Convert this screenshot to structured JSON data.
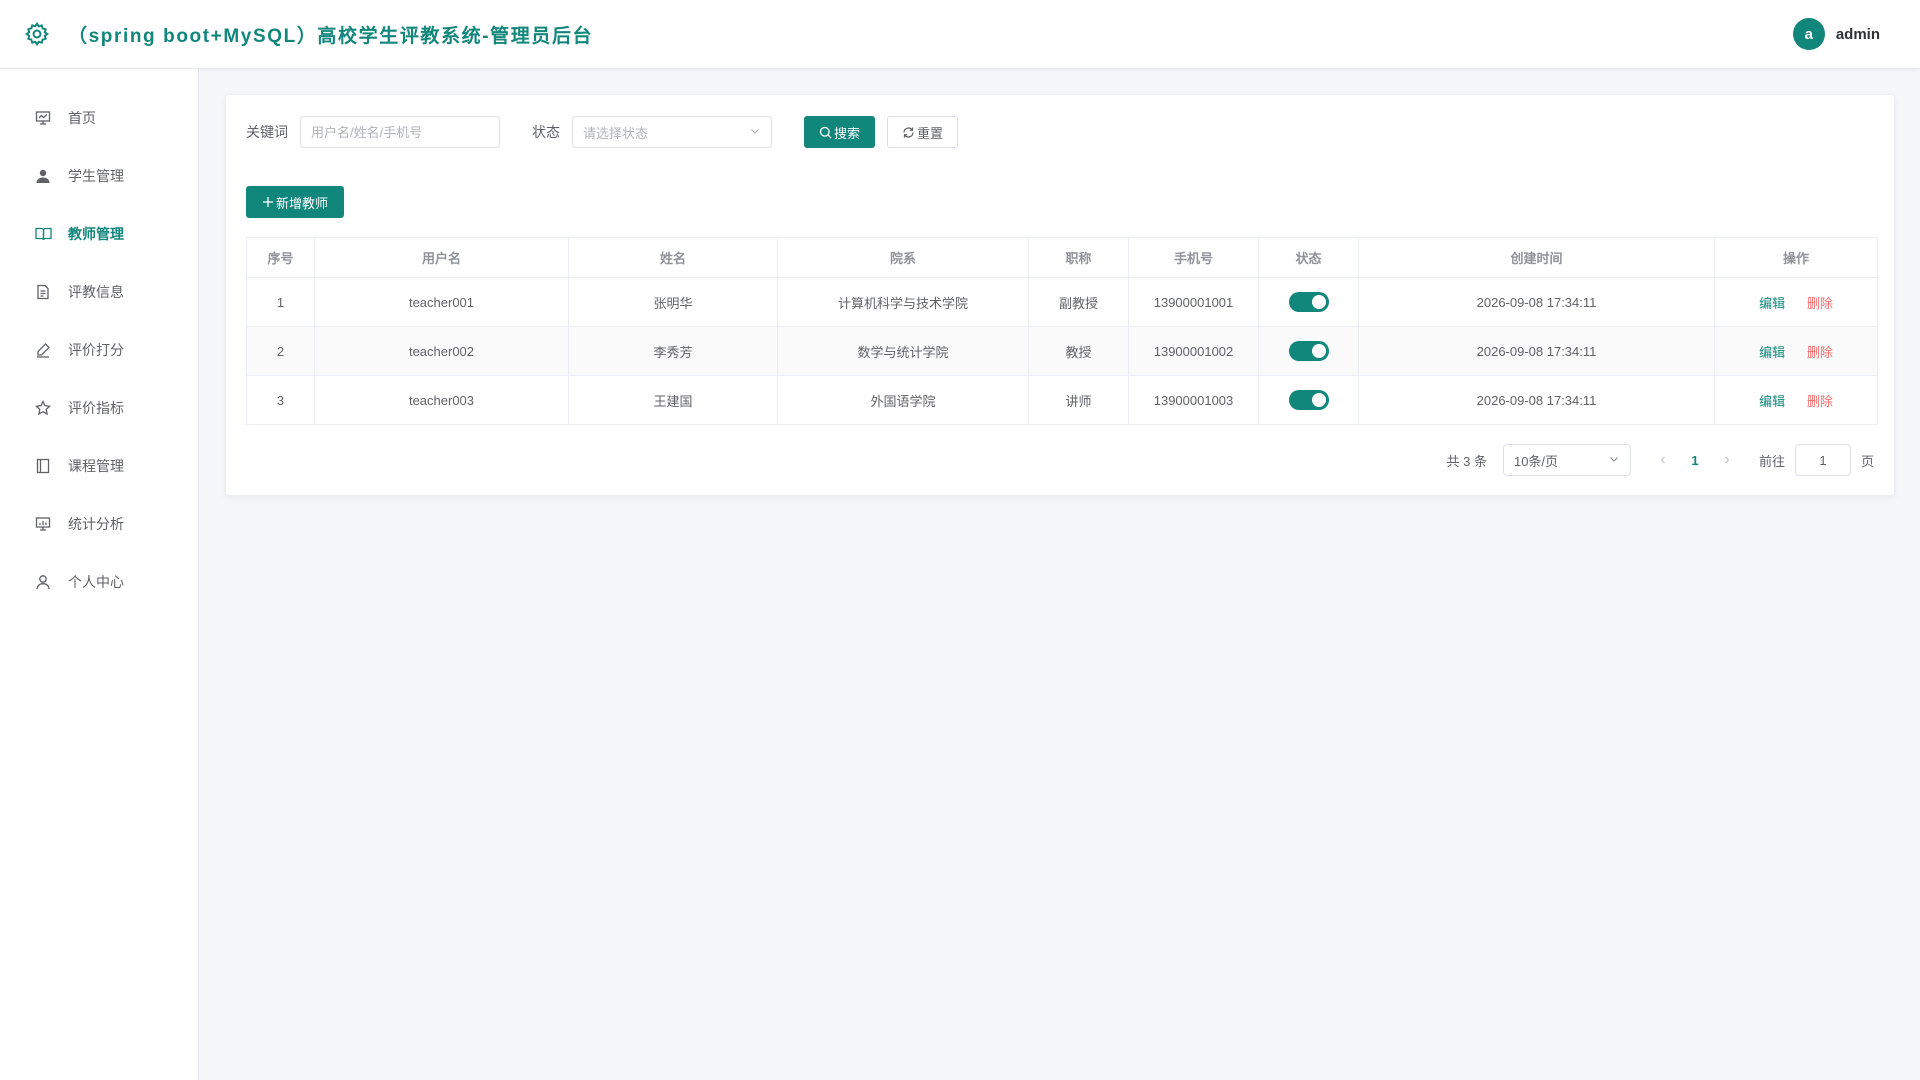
{
  "header": {
    "title": "（spring boot+MySQL）高校学生评教系统-管理员后台",
    "avatar_letter": "a",
    "username": "admin"
  },
  "sidebar": {
    "items": [
      {
        "label": "首页",
        "icon": "dashboard-icon",
        "active": false
      },
      {
        "label": "学生管理",
        "icon": "user-icon",
        "active": false
      },
      {
        "label": "教师管理",
        "icon": "book-icon",
        "active": true
      },
      {
        "label": "评教信息",
        "icon": "document-icon",
        "active": false
      },
      {
        "label": "评价打分",
        "icon": "edit-pen-icon",
        "active": false
      },
      {
        "label": "评价指标",
        "icon": "star-icon",
        "active": false
      },
      {
        "label": "课程管理",
        "icon": "notebook-icon",
        "active": false
      },
      {
        "label": "统计分析",
        "icon": "chart-board-icon",
        "active": false
      },
      {
        "label": "个人中心",
        "icon": "person-icon",
        "active": false
      }
    ]
  },
  "filter": {
    "keyword_label": "关键词",
    "keyword_placeholder": "用户名/姓名/手机号",
    "keyword_value": "",
    "status_label": "状态",
    "status_placeholder": "请选择状态",
    "search_label": "搜索",
    "reset_label": "重置"
  },
  "actions": {
    "add_label": "新增教师"
  },
  "table": {
    "columns": [
      "序号",
      "用户名",
      "姓名",
      "院系",
      "职称",
      "手机号",
      "状态",
      "创建时间",
      "操作"
    ],
    "rows": [
      {
        "index": "1",
        "username": "teacher001",
        "name": "张明华",
        "dept": "计算机科学与技术学院",
        "title": "副教授",
        "phone": "13900001001",
        "enabled": true,
        "created": "2026-09-08 17:34:11"
      },
      {
        "index": "2",
        "username": "teacher002",
        "name": "李秀芳",
        "dept": "数学与统计学院",
        "title": "教授",
        "phone": "13900001002",
        "enabled": true,
        "created": "2026-09-08 17:34:11"
      },
      {
        "index": "3",
        "username": "teacher003",
        "name": "王建国",
        "dept": "外国语学院",
        "title": "讲师",
        "phone": "13900001003",
        "enabled": true,
        "created": "2026-09-08 17:34:11"
      }
    ],
    "edit_label": "编辑",
    "delete_label": "删除"
  },
  "pagination": {
    "total_text": "共 3 条",
    "page_size": "10条/页",
    "current_page": "1",
    "goto_label": "前往",
    "goto_value": "1",
    "page_suffix": "页"
  },
  "colors": {
    "primary": "#11877c",
    "danger": "#f56c6c"
  }
}
